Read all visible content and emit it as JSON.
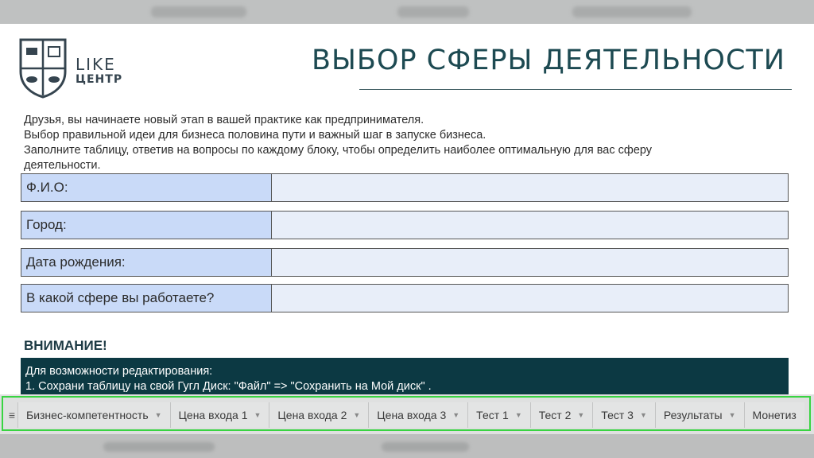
{
  "logo": {
    "line1": "LIKE",
    "line2": "ЦЕНТР"
  },
  "title": "ВЫБОР СФЕРЫ ДЕЯТЕЛЬНОСТИ",
  "intro": [
    "Друзья, вы начинаете новый этап в вашей практике как предпринимателя.",
    "Выбор правильной идеи для бизнеса половина пути и важный шаг в запуске бизнеса.",
    "Заполните таблицу, ответив на вопросы по каждому блоку, чтобы определить наиболее оптимальную для вас сферу",
    "деятельности."
  ],
  "form": {
    "fields": [
      {
        "label": "Ф.И.О:",
        "value": ""
      },
      {
        "label": "Город:",
        "value": ""
      },
      {
        "label": "Дата рождения:",
        "value": ""
      },
      {
        "label": "В какой сфере вы работаете?",
        "value": ""
      }
    ]
  },
  "warning": {
    "title": "ВНИМАНИЕ!",
    "lines": [
      "Для возможности редактирования:",
      "1. Сохрани таблицу на свой Гугл Диск: \"Файл\" => \"Сохранить на Мой диск\" ."
    ]
  },
  "sheet_tabs": {
    "menu_icon": "sheets-list-icon",
    "tabs": [
      {
        "label": "Бизнес-компетентность"
      },
      {
        "label": "Цена входа 1"
      },
      {
        "label": "Цена входа 2"
      },
      {
        "label": "Цена входа 3"
      },
      {
        "label": "Тест 1"
      },
      {
        "label": "Тест 2"
      },
      {
        "label": "Тест 3"
      },
      {
        "label": "Результаты"
      },
      {
        "label": "Монетиз"
      }
    ]
  },
  "colors": {
    "title": "#1d4a52",
    "label_bg": "#c9daf8",
    "value_bg": "#e8eef9",
    "notice_bg": "#0c3943",
    "highlight": "#39d442"
  }
}
